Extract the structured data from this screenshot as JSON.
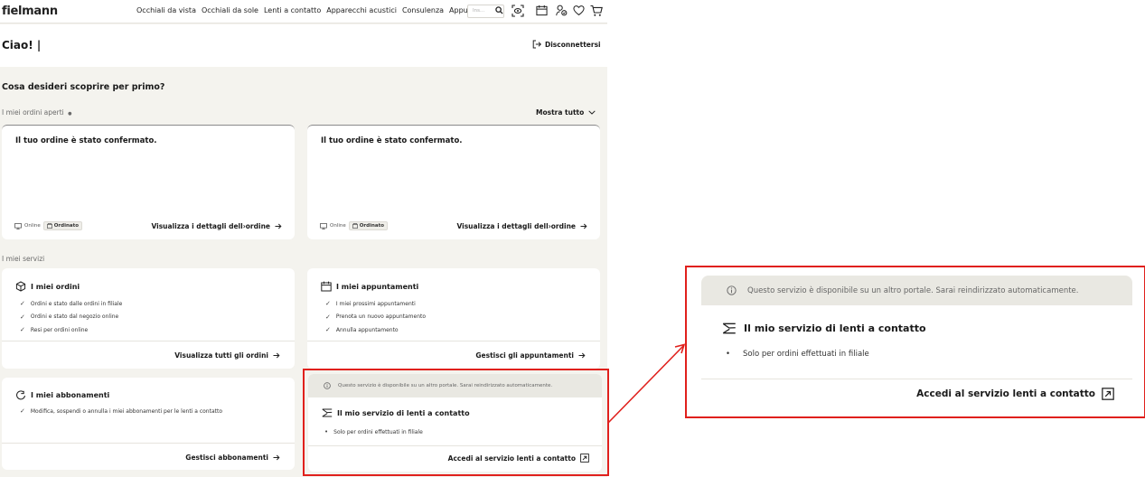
{
  "header": {
    "logo": "fielmann",
    "nav": [
      "Occhiali da vista",
      "Occhiali da sole",
      "Lenti a contatto",
      "Apparecchi acustici",
      "Consulenza",
      "Appuntamenti"
    ],
    "search_placeholder": "Ins..."
  },
  "greeting": "Ciao! |",
  "logout": "Disconnettersi",
  "question": "Cosa desideri scoprire per primo?",
  "orders_section": {
    "label": "I miei ordini aperti",
    "dot": "●",
    "show_all": "Mostra tutto",
    "cards": [
      {
        "title": "Il tuo ordine è stato confermato.",
        "channel": "Online",
        "status": "Ordinato",
        "link": "Visualizza i dettagli dell›ordine"
      },
      {
        "title": "Il tuo ordine è stato confermato.",
        "channel": "Online",
        "status": "Ordinato",
        "link": "Visualizza i dettagli dell›ordine"
      }
    ]
  },
  "services_label": "I miei servizi",
  "services": {
    "orders": {
      "title": "I miei ordini",
      "items": [
        "Ordini e stato dalle ordini in filiale",
        "Ordini e stato dal negozio online",
        "Resi per ordini online"
      ],
      "link": "Visualizza tutti gli ordini"
    },
    "appointments": {
      "title": "I miei appuntamenti",
      "items": [
        "I miei prossimi appuntamenti",
        "Prenota un nuovo appuntamento",
        "Annulla appuntamento"
      ],
      "link": "Gestisci gli appuntamenti"
    },
    "subscriptions": {
      "title": "I miei abbonamenti",
      "items": [
        "Modifica, sospendi o annulla i miei abbonamenti per le lenti a contatto"
      ],
      "link": "Gestisci abbonamenti"
    },
    "lenses": {
      "info": "Questo servizio è disponibile su un altro portale. Sarai reindirizzato automaticamente.",
      "title": "Il mio servizio di lenti a contatto",
      "bullet": "Solo per ordini effettuati in filiale",
      "link": "Accedi al servizio lenti a contatto"
    }
  },
  "colors": {
    "highlight": "#e0201c",
    "background": "#f4f3ee",
    "info_band": "#e9e8e2"
  }
}
